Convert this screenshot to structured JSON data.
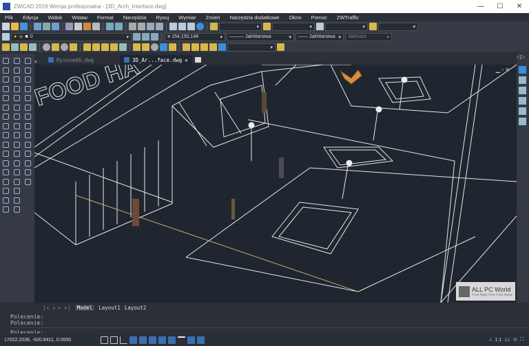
{
  "window": {
    "title": "ZWCAD 2019 Wersja profesjonalna - [3D_Arch_Interface.dwg]",
    "minimize": "—",
    "maximize": "☐",
    "close": "✕"
  },
  "menu": [
    "Plik",
    "Edycja",
    "Widok",
    "Wstaw",
    "Format",
    "Narzędzia",
    "Rysuj",
    "Wymiar",
    "Zmień",
    "Narzędzia dodatkowe",
    "Okno",
    "Pomoc",
    "ZWTraffic"
  ],
  "toolbar": {
    "layer": "0",
    "color": "154,150,148",
    "linetype": "JakWarstwa",
    "lineweight": "JakWarstwa",
    "plotstyle": "JakKolor"
  },
  "file_tabs": [
    {
      "label": "Rysunek6.dwg",
      "active": false
    },
    {
      "label": "3D_Ar...face.dwg",
      "active": true
    }
  ],
  "drawing": {
    "sign_text": "FOOD HA"
  },
  "layout_tabs": [
    "Model",
    "Layout1",
    "Layout2"
  ],
  "command_lines": [
    "Polecenie:",
    "Polecenie:"
  ],
  "command_prompt": "Polecenie:",
  "status": {
    "coordinates": "17022.2036, -620.8411, 0.0000",
    "scale": "1:1"
  },
  "watermark": {
    "title": "ALL PC World",
    "subtitle": "Free Apps One Click Away"
  },
  "colors": {
    "canvas": "#1f2630",
    "accent": "#3b8fd9"
  }
}
